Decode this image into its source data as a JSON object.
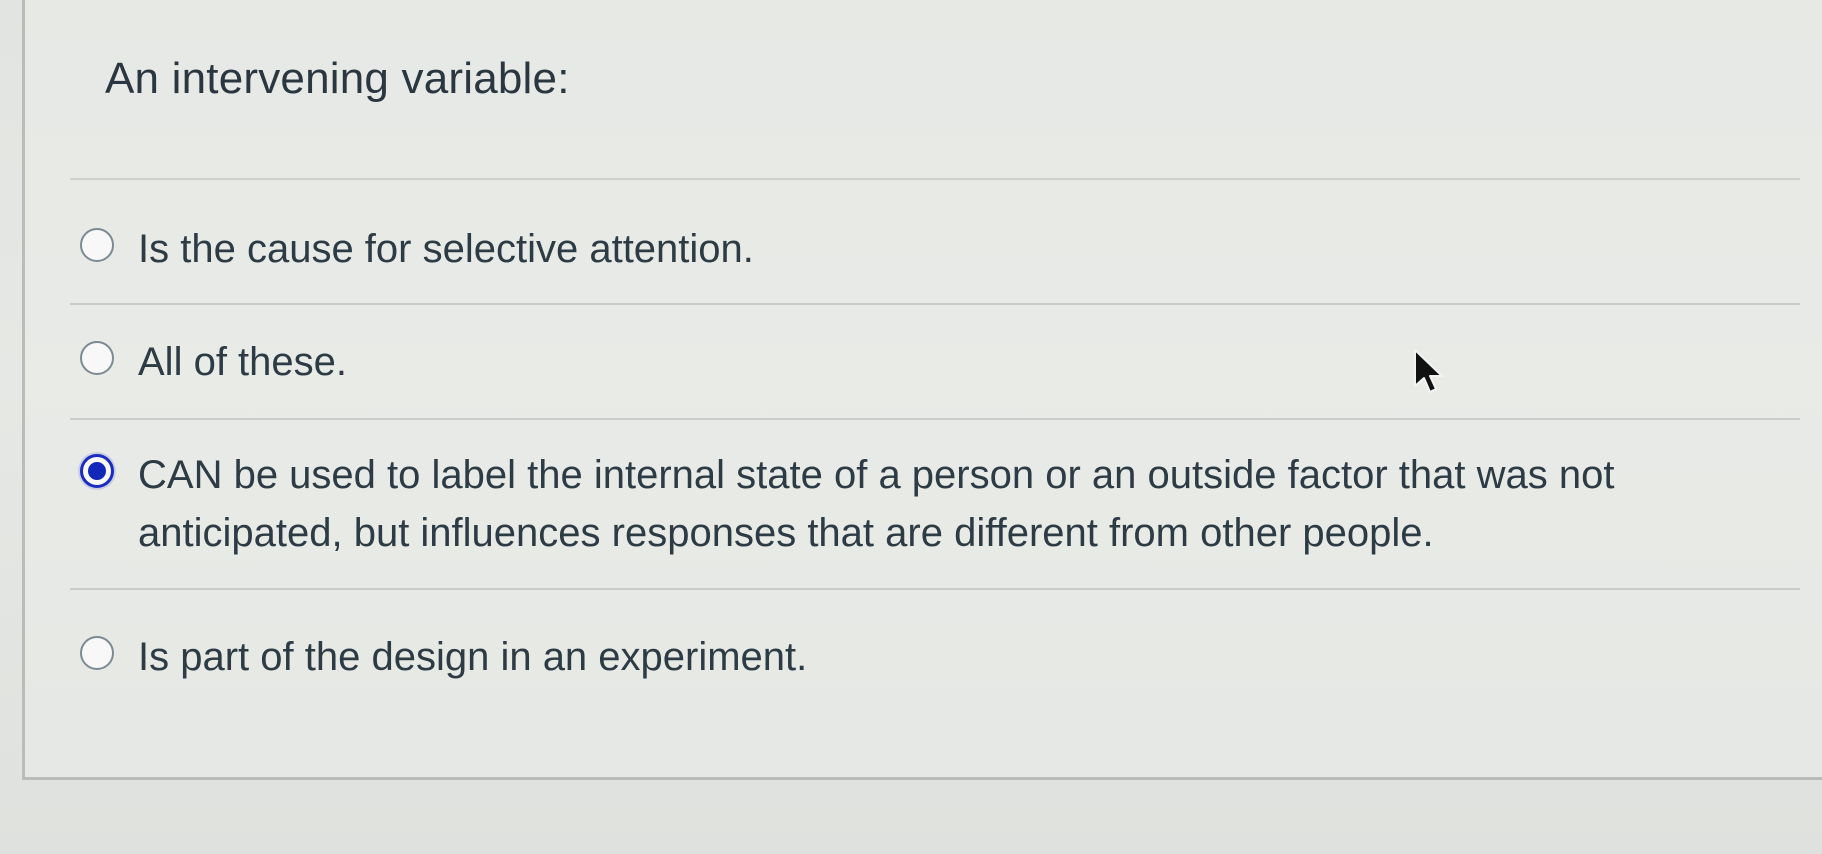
{
  "question": {
    "text": "An intervening variable:"
  },
  "answers": [
    {
      "label": "Is the cause for selective attention.",
      "selected": false
    },
    {
      "label": "All of these.",
      "selected": false
    },
    {
      "label": "CAN be used to label the internal state of a person or an outside factor that was not anticipated, but influences responses that are different from other people.",
      "selected": true
    },
    {
      "label": "Is part of the design in an experiment.",
      "selected": false
    }
  ],
  "colors": {
    "selected_radio": "#1228b8",
    "text": "#2d3b45",
    "background": "#e4e6e3"
  },
  "icons": {
    "cursor": "mouse-pointer-icon"
  }
}
